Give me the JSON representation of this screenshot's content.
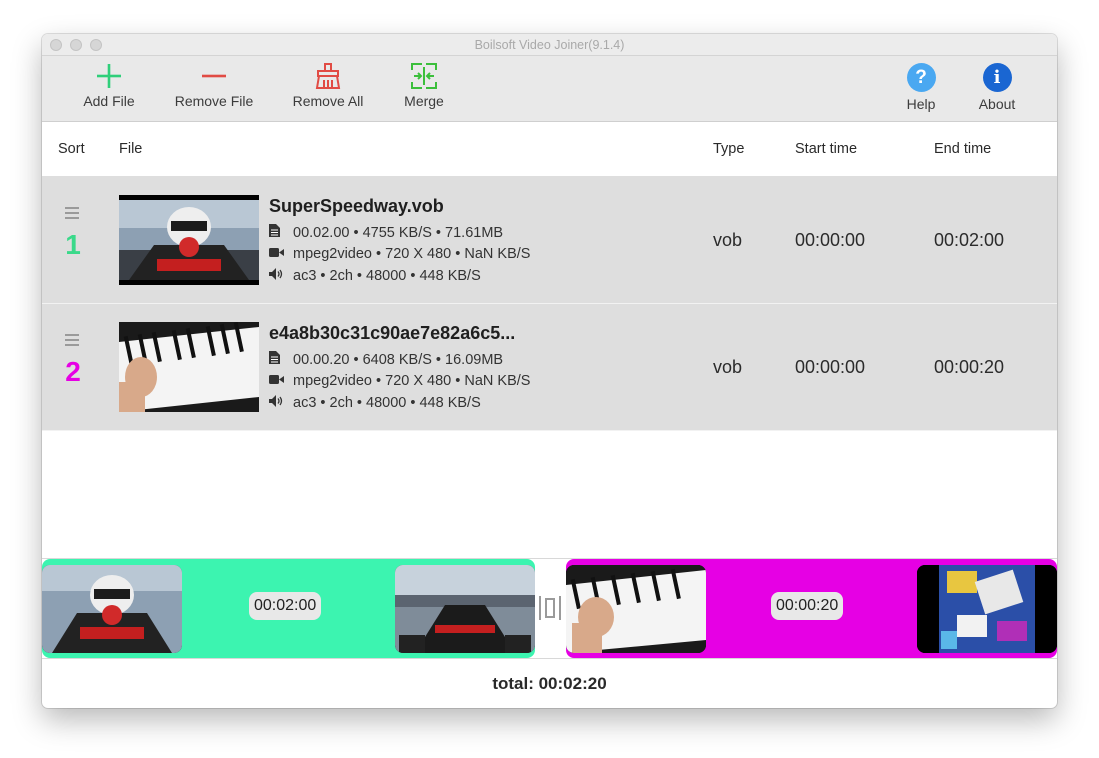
{
  "window": {
    "title": "Boilsoft Video Joiner(9.1.4)"
  },
  "toolbar": {
    "add_label": "Add File",
    "remove_label": "Remove File",
    "remove_all_label": "Remove All",
    "merge_label": "Merge",
    "help_label": "Help",
    "about_label": "About",
    "help_glyph": "?",
    "about_glyph": "i",
    "colors": {
      "add": "#2fcf7a",
      "remove": "#e14b44",
      "remove_all": "#e14b44",
      "merge": "#3bbf3b",
      "help": "#4aa8f1",
      "about": "#1a66d2"
    }
  },
  "columns": {
    "sort": "Sort",
    "file": "File",
    "type": "Type",
    "start": "Start time",
    "end": "End time"
  },
  "files": [
    {
      "index": "1",
      "color": "#3ad98a",
      "name": "SuperSpeedway.vob",
      "info": "00.02.00 • 4755 KB/S • 71.61MB",
      "video": "mpeg2video • 720 X 480 • NaN KB/S",
      "audio": "ac3 • 2ch • 48000 • 448 KB/S",
      "type": "vob",
      "start": "00:00:00",
      "end": "00:02:00"
    },
    {
      "index": "2",
      "color": "#e600e4",
      "name": "e4a8b30c31c90ae7e82a6c5...",
      "info": "00.00.20 • 6408 KB/S • 16.09MB",
      "video": "mpeg2video • 720 X 480 • NaN KB/S",
      "audio": "ac3 • 2ch • 48000 • 448 KB/S",
      "type": "vob",
      "start": "00:00:00",
      "end": "00:00:20"
    }
  ],
  "timeline": [
    {
      "duration": "00:02:00",
      "color": "#3cf4b0"
    },
    {
      "duration": "00:00:20",
      "color": "#e600e4"
    }
  ],
  "footer": {
    "total": "total: 00:02:20"
  }
}
